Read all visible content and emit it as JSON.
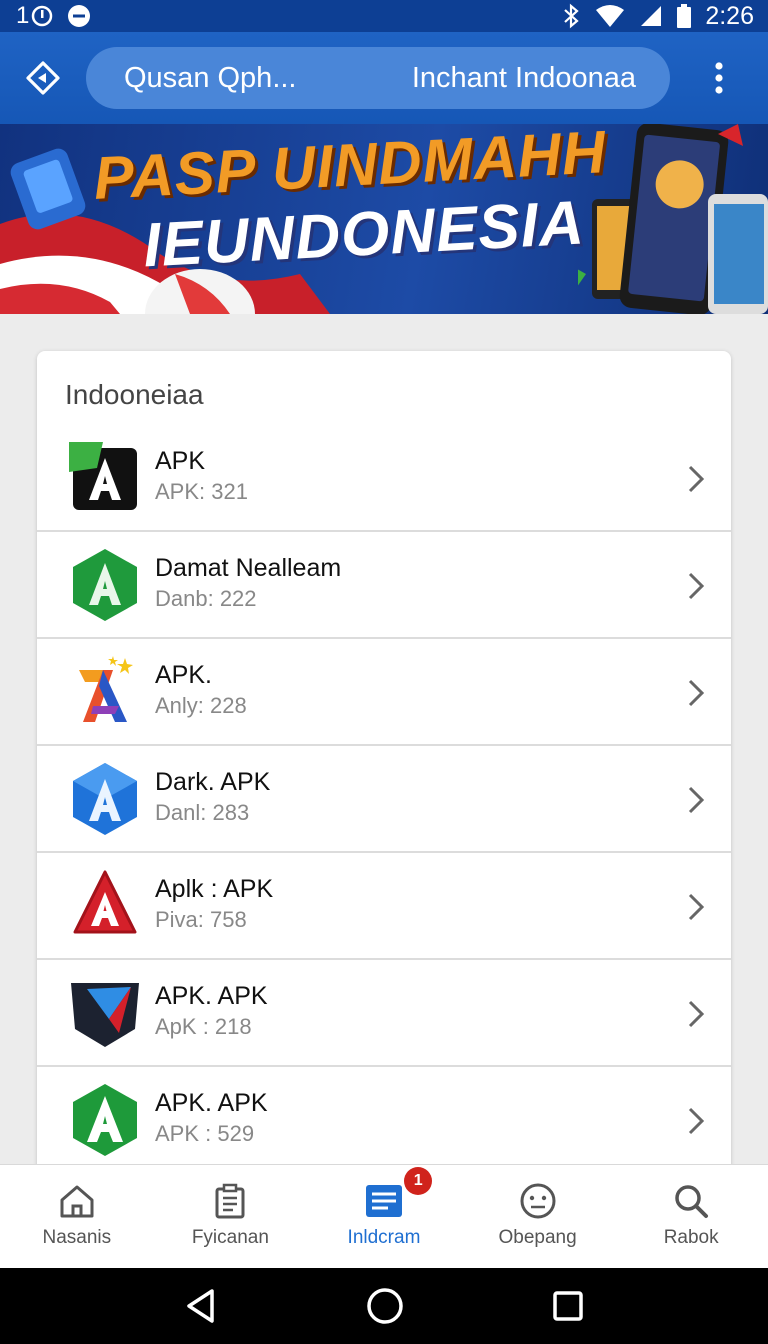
{
  "status_bar": {
    "left_text": "1",
    "time": "2:26"
  },
  "app_bar": {
    "search_left": "Qusan Qph...",
    "search_right": "Inchant Indoonaa"
  },
  "banner": {
    "line1": "PASP UINDMAHH",
    "line2": "IEUNDONESIA"
  },
  "list": {
    "title": "Indooneiaa",
    "items": [
      {
        "title": "APK",
        "subtitle": "APK: 321",
        "icon": "apk-black-icon"
      },
      {
        "title": "Damat Nealleam",
        "subtitle": "Danb: 222",
        "icon": "green-hex-icon"
      },
      {
        "title": "APK.",
        "subtitle": "Anly: 228",
        "icon": "colorful-star-icon"
      },
      {
        "title": "Dark. APK",
        "subtitle": "Danl: 283",
        "icon": "blue-hex-icon"
      },
      {
        "title": "Aplk : APK",
        "subtitle": "Piva: 758",
        "icon": "red-hex-icon"
      },
      {
        "title": "APK. APK",
        "subtitle": "ApK : 218",
        "icon": "dark-shield-icon"
      },
      {
        "title": "APK. APK",
        "subtitle": "APK : 529",
        "icon": "green-shield-icon"
      }
    ]
  },
  "bottom_nav": {
    "items": [
      {
        "label": "Nasanis",
        "icon": "home-icon"
      },
      {
        "label": "Fyicanan",
        "icon": "document-icon"
      },
      {
        "label": "Inldcram",
        "icon": "list-icon",
        "badge": "1"
      },
      {
        "label": "Obepang",
        "icon": "smiley-icon"
      },
      {
        "label": "Rabok",
        "icon": "search-icon"
      }
    ]
  },
  "colors": {
    "primary": "#1f63c4",
    "accent": "#1f6fd1",
    "badge": "#d0231c",
    "status_bar": "#0d3f94"
  }
}
